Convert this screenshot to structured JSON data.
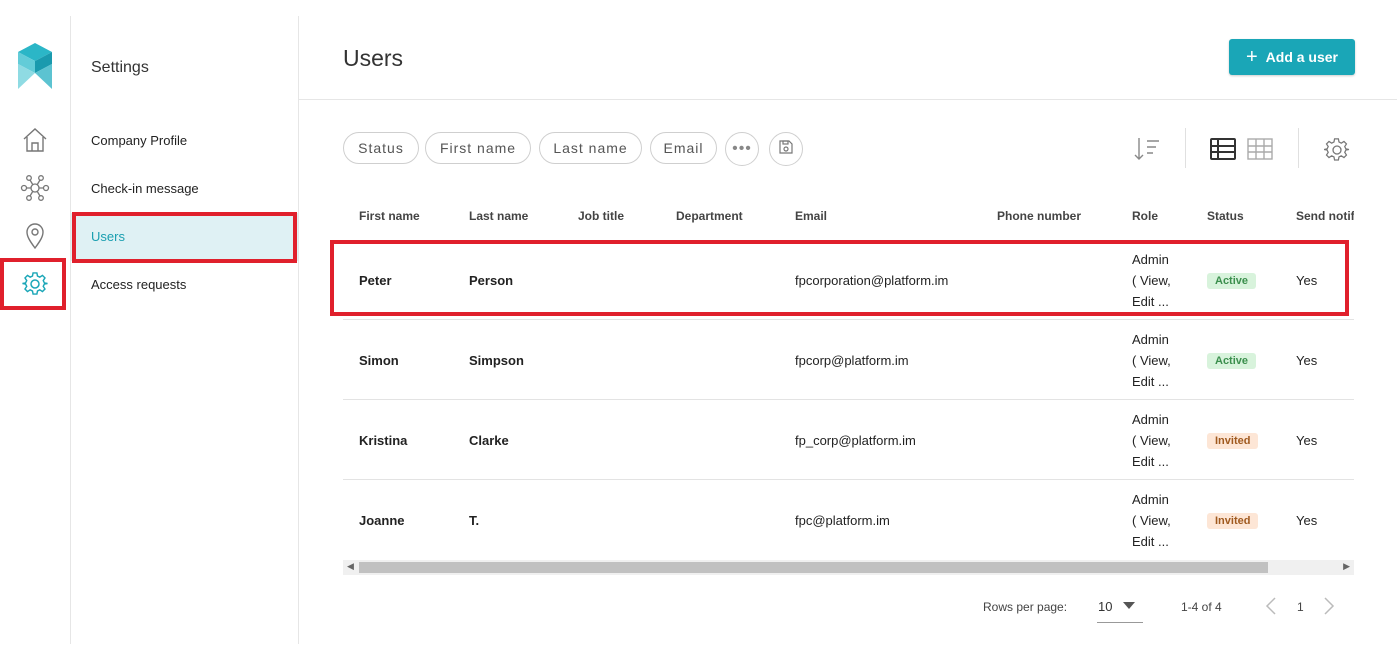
{
  "rail": {
    "items": [
      {
        "name": "home-icon"
      },
      {
        "name": "network-icon"
      },
      {
        "name": "location-pin-icon"
      },
      {
        "name": "gear-icon",
        "active": true
      }
    ],
    "accent": "#1aa6b7"
  },
  "settings": {
    "title": "Settings",
    "items": [
      {
        "label": "Company Profile"
      },
      {
        "label": "Check-in message"
      },
      {
        "label": "Users",
        "active": true
      },
      {
        "label": "Access requests"
      }
    ]
  },
  "header": {
    "title": "Users",
    "add_button_label": "Add a user"
  },
  "filters": {
    "chips": [
      "Status",
      "First name",
      "Last name",
      "Email"
    ],
    "more_icon": "ellipsis-icon",
    "save_icon": "floppy-disk-icon"
  },
  "toolbar": {
    "icons": [
      "sort-icon",
      "list-view-icon",
      "grid-view-icon",
      "gear-icon"
    ]
  },
  "table": {
    "columns": [
      "First name",
      "Last name",
      "Job title",
      "Department",
      "Email",
      "Phone number",
      "Role",
      "Status",
      "Send notif"
    ],
    "rows": [
      {
        "first": "Peter",
        "last": "Person",
        "job": "",
        "dept": "",
        "email": "fpcorporation@platform.im",
        "phone": "",
        "role": [
          "Admin",
          "( View,",
          "Edit ..."
        ],
        "status": "Active",
        "notify": "Yes"
      },
      {
        "first": "Simon",
        "last": "Simpson",
        "job": "",
        "dept": "",
        "email": "fpcorp@platform.im",
        "phone": "",
        "role": [
          "Admin",
          "( View,",
          "Edit ..."
        ],
        "status": "Active",
        "notify": "Yes"
      },
      {
        "first": "Kristina",
        "last": "Clarke",
        "job": "",
        "dept": "",
        "email": "fp_corp@platform.im",
        "phone": "",
        "role": [
          "Admin",
          "( View,",
          "Edit ..."
        ],
        "status": "Invited",
        "notify": "Yes"
      },
      {
        "first": "Joanne",
        "last": "T.",
        "job": "",
        "dept": "",
        "email": "fpc@platform.im",
        "phone": "",
        "role": [
          "Admin",
          "( View,",
          "Edit ..."
        ],
        "status": "Invited",
        "notify": "Yes"
      }
    ]
  },
  "pagination": {
    "rows_per_page_label": "Rows per page:",
    "rows_per_page_value": "10",
    "range": "1-4 of 4",
    "page": "1"
  },
  "colors": {
    "highlight": "#e0202c",
    "active_badge_bg": "#d8f3dc",
    "invited_badge_bg": "#fde6d6"
  }
}
